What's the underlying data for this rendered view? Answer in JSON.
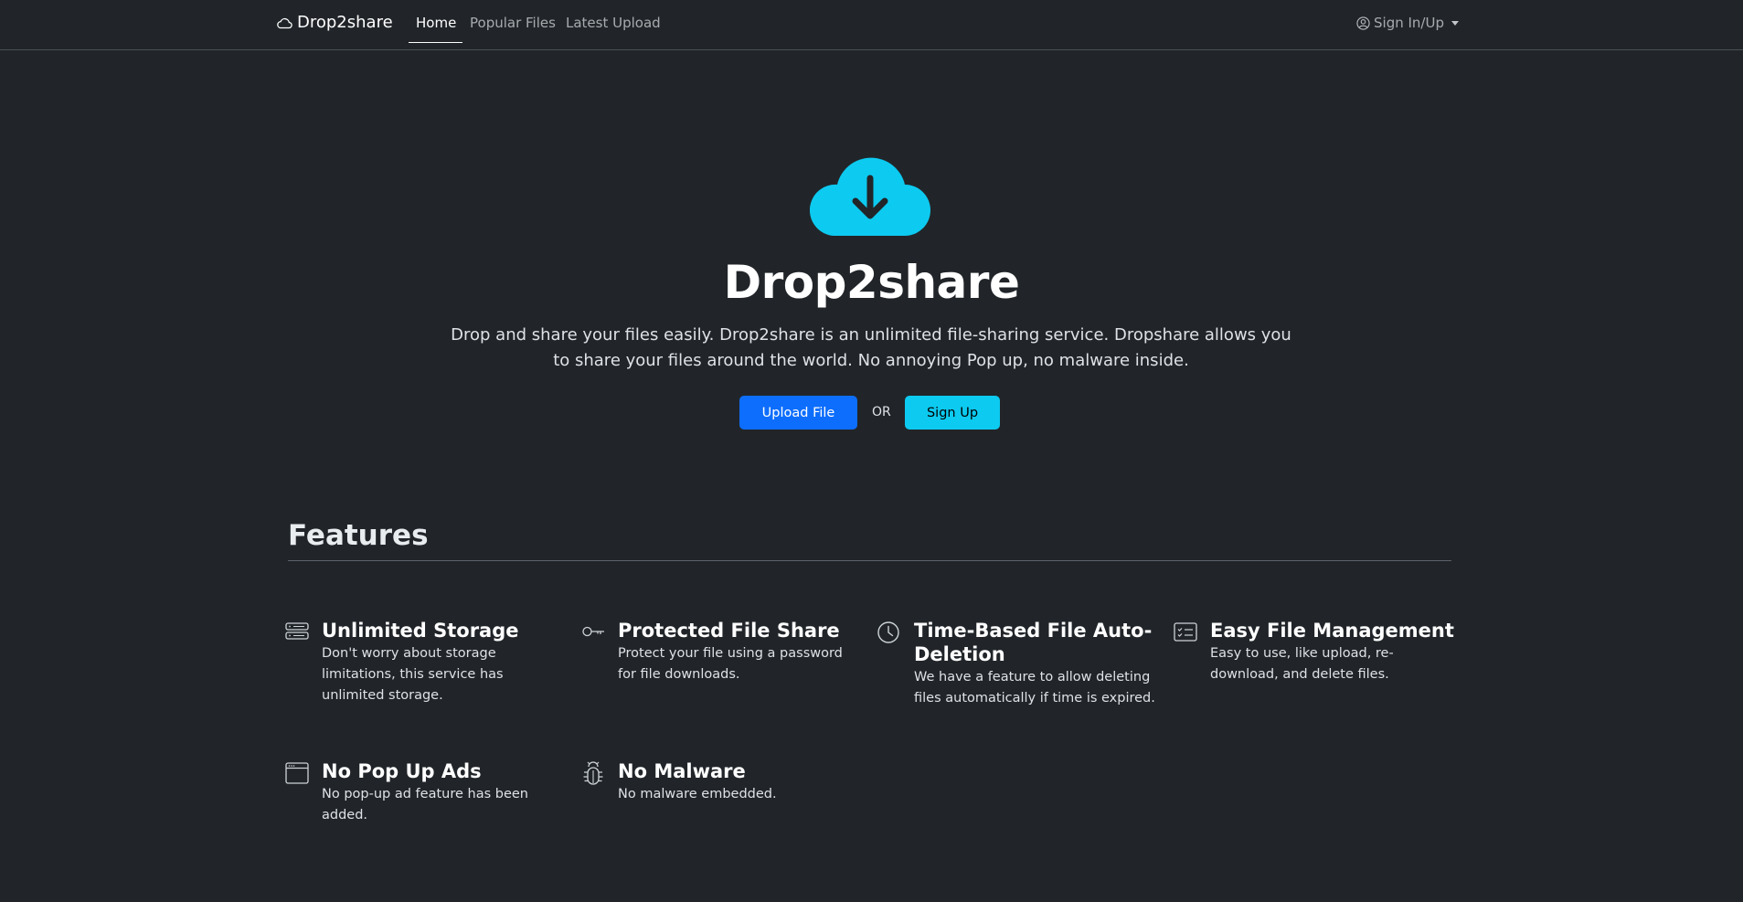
{
  "nav": {
    "brand": "Drop2share",
    "links": [
      {
        "label": "Home",
        "active": true
      },
      {
        "label": "Popular Files",
        "active": false
      },
      {
        "label": "Latest Upload",
        "active": false
      }
    ],
    "signin_label": "Sign In/Up"
  },
  "hero": {
    "title": "Drop2share",
    "description": "Drop and share your files easily. Drop2share is an unlimited file-sharing service. Dropshare allows you to share your files around the world. No annoying Pop up, no malware inside.",
    "upload_label": "Upload File",
    "or_label": "OR",
    "signup_label": "Sign Up"
  },
  "features": {
    "heading": "Features",
    "items": [
      {
        "icon": "hdd-stack-icon",
        "title": "Unlimited Storage",
        "text": "Don't worry about storage limitations, this service has unlimited storage."
      },
      {
        "icon": "key-icon",
        "title": "Protected File Share",
        "text": "Protect your file using a password for file downloads."
      },
      {
        "icon": "clock-icon",
        "title": "Time-Based File Auto-Deletion",
        "text": "We have a feature to allow deleting files automatically if time is expired."
      },
      {
        "icon": "card-checklist-icon",
        "title": "Easy File Management",
        "text": "Easy to use, like upload, re-download, and delete files."
      },
      {
        "icon": "window-icon",
        "title": "No Pop Up Ads",
        "text": "No pop-up ad feature has been added."
      },
      {
        "icon": "bug-icon",
        "title": "No Malware",
        "text": "No malware embedded."
      }
    ]
  },
  "colors": {
    "background": "#212529",
    "primary": "#0d6efd",
    "info": "#0dcaf0"
  }
}
